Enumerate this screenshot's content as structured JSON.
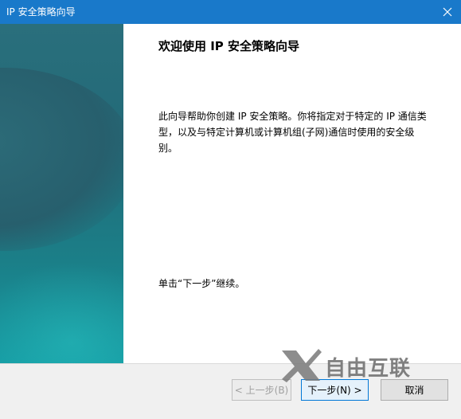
{
  "window": {
    "title": "IP 安全策略向导",
    "close_icon": "close-icon"
  },
  "wizard": {
    "heading": "欢迎使用 IP 安全策略向导",
    "description": "此向导帮助你创建 IP 安全策略。你将指定对于特定的 IP 通信类型，以及与特定计算机或计算机组(子网)通信时使用的安全级别。",
    "continue_hint": "单击“下一步”继续。"
  },
  "buttons": {
    "back": "< 上一步(B)",
    "next": "下一步(N) >",
    "cancel": "取消"
  },
  "watermark": {
    "text": "自由互联"
  },
  "colors": {
    "titlebar": "#1979ca",
    "side_panel": "#226a78",
    "content_bg": "#ffffff"
  }
}
